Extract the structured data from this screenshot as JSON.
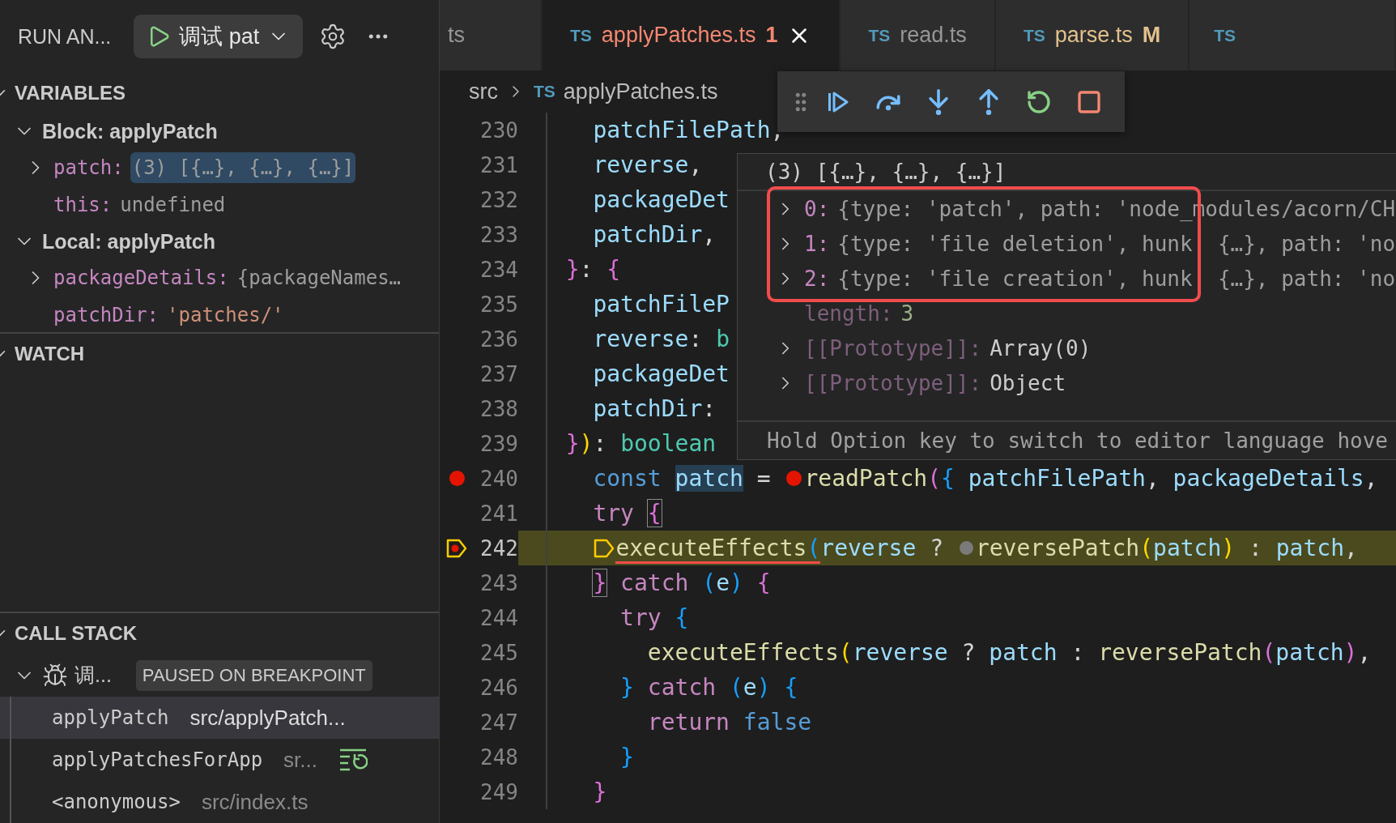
{
  "sidebar": {
    "title": "RUN AN...",
    "config": {
      "label": "调试 pat"
    },
    "variables": {
      "title": "VARIABLES",
      "expanded": true,
      "scopes": [
        {
          "label": "Block: applyPatch",
          "expanded": true,
          "children": [
            {
              "name": "patch:",
              "value": "(3) [{…}, {…}, {…}]",
              "kind": "object",
              "expandable": true,
              "selected": true
            },
            {
              "name": "this:",
              "value": "undefined",
              "kind": "undefined",
              "expandable": false,
              "selected": false
            }
          ]
        },
        {
          "label": "Local: applyPatch",
          "expanded": true,
          "children": [
            {
              "name": "packageDetails:",
              "value": "{packageNames…",
              "kind": "object",
              "expandable": true,
              "selected": false
            },
            {
              "name": "patchDir:",
              "value": "'patches/'",
              "kind": "string",
              "expandable": false,
              "selected": false
            }
          ]
        }
      ]
    },
    "watch": {
      "title": "WATCH",
      "expanded": true
    },
    "call_stack": {
      "title": "CALL STACK",
      "expanded": true,
      "thread": {
        "label": "调...",
        "expanded": true,
        "badge": "PAUSED ON BREAKPOINT"
      },
      "frames": [
        {
          "name": "applyPatch",
          "source": "src/applyPatch...",
          "selected": true,
          "restartable": false
        },
        {
          "name": "applyPatchesForApp",
          "source": "sr...",
          "selected": false,
          "restartable": true
        },
        {
          "name": "<anonymous>",
          "source": "src/index.ts",
          "selected": false,
          "restartable": false
        }
      ]
    }
  },
  "tabs": [
    {
      "label": "ts",
      "selected": false,
      "kind": "partial"
    },
    {
      "lang": "TS",
      "label": "applyPatches.ts",
      "badge": "1",
      "color": "#f48771",
      "selected": true,
      "closable": true,
      "kind": "file"
    },
    {
      "lang": "TS",
      "label": "read.ts",
      "selected": false,
      "kind": "file"
    },
    {
      "lang": "TS",
      "label": "parse.ts",
      "badge": "M",
      "color": "#e2c08d",
      "selected": false,
      "kind": "file"
    },
    {
      "lang": "TS",
      "selected": false,
      "kind": "partial"
    }
  ],
  "breadcrumb": {
    "folder": "src",
    "file_lang": "TS",
    "file": "applyPatches.ts"
  },
  "debug_toolbar": {
    "actions": [
      {
        "kind": "continue"
      },
      {
        "kind": "step_over"
      },
      {
        "kind": "step_into"
      },
      {
        "kind": "step_out"
      },
      {
        "kind": "restart"
      },
      {
        "kind": "stop"
      }
    ]
  },
  "editor": {
    "lines": [
      {
        "number": "230",
        "tokens": [
          {
            "kind": "indent"
          },
          {
            "kind": "indent"
          },
          {
            "text": "patchFilePath",
            "kind": "var"
          },
          {
            "text": ",",
            "kind": "p"
          }
        ]
      },
      {
        "number": "231",
        "tokens": [
          {
            "kind": "indent"
          },
          {
            "kind": "indent"
          },
          {
            "text": "reverse",
            "kind": "var"
          },
          {
            "text": ",",
            "kind": "p"
          }
        ]
      },
      {
        "number": "232",
        "tokens": [
          {
            "kind": "indent"
          },
          {
            "kind": "indent"
          },
          {
            "text": "packageDet",
            "kind": "var"
          }
        ]
      },
      {
        "number": "233",
        "tokens": [
          {
            "kind": "indent"
          },
          {
            "kind": "indent"
          },
          {
            "text": "patchDir",
            "kind": "var"
          },
          {
            "text": ",",
            "kind": "p"
          }
        ]
      },
      {
        "number": "234",
        "tokens": [
          {
            "kind": "indent"
          },
          {
            "text": "}",
            "kind": "b2"
          },
          {
            "text": ": ",
            "kind": "p"
          },
          {
            "text": "{",
            "kind": "b2"
          }
        ]
      },
      {
        "number": "235",
        "tokens": [
          {
            "kind": "indent"
          },
          {
            "kind": "indent"
          },
          {
            "text": "patchFileP",
            "kind": "var"
          }
        ]
      },
      {
        "number": "236",
        "tokens": [
          {
            "kind": "indent"
          },
          {
            "kind": "indent"
          },
          {
            "text": "reverse",
            "kind": "var"
          },
          {
            "text": ": ",
            "kind": "p"
          },
          {
            "text": "b",
            "kind": "ty"
          }
        ]
      },
      {
        "number": "237",
        "tokens": [
          {
            "kind": "indent"
          },
          {
            "kind": "indent"
          },
          {
            "text": "packageDet",
            "kind": "var"
          }
        ]
      },
      {
        "number": "238",
        "tokens": [
          {
            "kind": "indent"
          },
          {
            "kind": "indent"
          },
          {
            "text": "patchDir",
            "kind": "var"
          },
          {
            "text": ":",
            "kind": "p"
          }
        ]
      },
      {
        "number": "239",
        "tokens": [
          {
            "kind": "indent"
          },
          {
            "text": "}",
            "kind": "b2"
          },
          {
            "text": ")",
            "kind": "b1"
          },
          {
            "text": ": ",
            "kind": "p"
          },
          {
            "text": "boolean",
            "kind": "ty"
          }
        ]
      },
      {
        "number": "240",
        "breakpoint": true,
        "tokens": [
          {
            "kind": "indent"
          },
          {
            "kind": "indent"
          },
          {
            "text": "const ",
            "kind": "st"
          },
          {
            "text": "patch",
            "kind": "var",
            "highlight": true
          },
          {
            "text": " = ",
            "kind": "p"
          },
          {
            "kind": "bp"
          },
          {
            "text": "readPatch",
            "kind": "fn"
          },
          {
            "text": "(",
            "kind": "b2"
          },
          {
            "text": "{ ",
            "kind": "b3"
          },
          {
            "text": "patchFilePath",
            "kind": "var"
          },
          {
            "text": ", ",
            "kind": "p"
          },
          {
            "text": "packageDetails",
            "kind": "var"
          },
          {
            "text": ",",
            "kind": "p"
          }
        ]
      },
      {
        "number": "241",
        "tokens": [
          {
            "kind": "indent"
          },
          {
            "kind": "indent"
          },
          {
            "text": "try ",
            "kind": "kw"
          },
          {
            "text": "{",
            "kind": "b2",
            "boxed": true
          }
        ]
      },
      {
        "number": "242",
        "paused": true,
        "tokens": [
          {
            "kind": "indent"
          },
          {
            "kind": "indent"
          },
          {
            "kind": "exec"
          },
          {
            "text": "executeEffects",
            "kind": "fn",
            "error": true
          },
          {
            "text": "(",
            "kind": "b3",
            "error": true
          },
          {
            "text": "reverse",
            "kind": "var"
          },
          {
            "text": " ? ",
            "kind": "p"
          },
          {
            "kind": "bp_off"
          },
          {
            "text": "reversePatch",
            "kind": "fn"
          },
          {
            "text": "(",
            "kind": "b1"
          },
          {
            "text": "patch",
            "kind": "var"
          },
          {
            "text": ")",
            "kind": "b1"
          },
          {
            "text": " : ",
            "kind": "p"
          },
          {
            "text": "patch",
            "kind": "var"
          },
          {
            "text": ",",
            "kind": "p"
          }
        ]
      },
      {
        "number": "243",
        "tokens": [
          {
            "kind": "indent"
          },
          {
            "kind": "indent"
          },
          {
            "text": "}",
            "kind": "b2",
            "boxed": true
          },
          {
            "text": " catch ",
            "kind": "kw"
          },
          {
            "text": "(",
            "kind": "b3"
          },
          {
            "text": "e",
            "kind": "var"
          },
          {
            "text": ")",
            "kind": "b3"
          },
          {
            "text": " {",
            "kind": "b2"
          }
        ]
      },
      {
        "number": "244",
        "tokens": [
          {
            "kind": "indent"
          },
          {
            "kind": "indent"
          },
          {
            "kind": "indent"
          },
          {
            "text": "try ",
            "kind": "kw"
          },
          {
            "text": "{",
            "kind": "b3"
          }
        ]
      },
      {
        "number": "245",
        "tokens": [
          {
            "kind": "indent"
          },
          {
            "kind": "indent"
          },
          {
            "kind": "indent"
          },
          {
            "kind": "indent"
          },
          {
            "text": "executeEffects",
            "kind": "fn"
          },
          {
            "text": "(",
            "kind": "b1"
          },
          {
            "text": "reverse",
            "kind": "var"
          },
          {
            "text": " ? ",
            "kind": "p"
          },
          {
            "text": "patch",
            "kind": "var"
          },
          {
            "text": " : ",
            "kind": "p"
          },
          {
            "text": "reversePatch",
            "kind": "fn"
          },
          {
            "text": "(",
            "kind": "b2"
          },
          {
            "text": "patch",
            "kind": "var"
          },
          {
            "text": ")",
            "kind": "b2"
          },
          {
            "text": ",",
            "kind": "p"
          }
        ]
      },
      {
        "number": "246",
        "tokens": [
          {
            "kind": "indent"
          },
          {
            "kind": "indent"
          },
          {
            "kind": "indent"
          },
          {
            "text": "}",
            "kind": "b3"
          },
          {
            "text": " catch ",
            "kind": "kw"
          },
          {
            "text": "(",
            "kind": "b3"
          },
          {
            "text": "e",
            "kind": "var"
          },
          {
            "text": ")",
            "kind": "b3"
          },
          {
            "text": " {",
            "kind": "b3"
          }
        ]
      },
      {
        "number": "247",
        "tokens": [
          {
            "kind": "indent"
          },
          {
            "kind": "indent"
          },
          {
            "kind": "indent"
          },
          {
            "kind": "indent"
          },
          {
            "text": "return ",
            "kind": "kw"
          },
          {
            "text": "false",
            "kind": "st"
          }
        ]
      },
      {
        "number": "248",
        "tokens": [
          {
            "kind": "indent"
          },
          {
            "kind": "indent"
          },
          {
            "kind": "indent"
          },
          {
            "text": "}",
            "kind": "b3"
          }
        ]
      },
      {
        "number": "249",
        "tokens": [
          {
            "kind": "indent"
          },
          {
            "kind": "indent"
          },
          {
            "text": "}",
            "kind": "b2"
          }
        ]
      }
    ]
  },
  "hover": {
    "title": "(3) [{…}, {…}, {…}]",
    "rows": [
      {
        "key": "0:",
        "value": "{type: 'patch', path: 'node_modules/acorn/CH",
        "kind": "index",
        "expandable": true,
        "boxed": true
      },
      {
        "key": "1:",
        "value": "{type: 'file deletion', hunk  {…}, path: 'no",
        "kind": "index",
        "expandable": true,
        "boxed": true
      },
      {
        "key": "2:",
        "value": "{type: 'file creation', hunk  {…}, path: 'no",
        "kind": "index",
        "expandable": true,
        "boxed": true
      },
      {
        "key": "length:",
        "value": "3",
        "kind": "length",
        "expandable": false,
        "boxed": false
      },
      {
        "key": "[[Prototype]]:",
        "value": "Array(0)",
        "kind": "internal",
        "expandable": true,
        "boxed": false
      },
      {
        "key": "[[Prototype]]:",
        "value": "Object",
        "kind": "internal",
        "expandable": true,
        "boxed": false
      }
    ],
    "footer": "Hold Option key to switch to editor language hove"
  }
}
